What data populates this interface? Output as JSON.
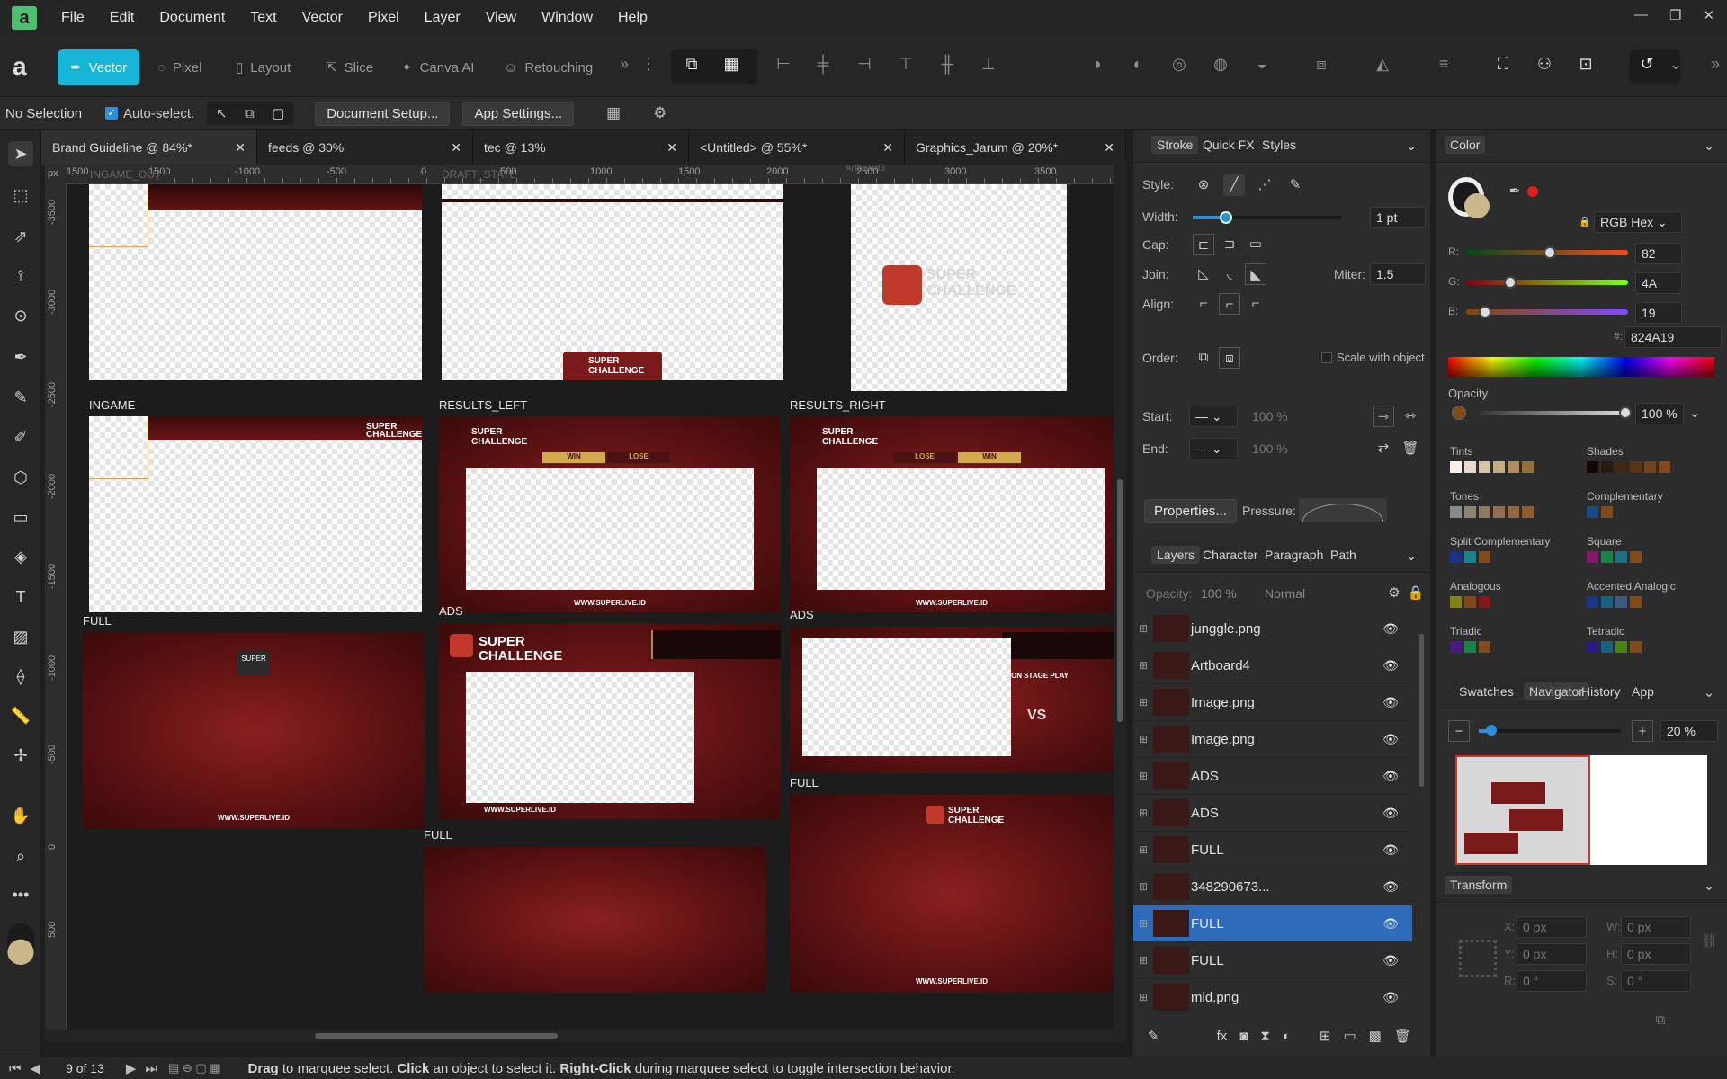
{
  "menu": [
    "File",
    "Edit",
    "Document",
    "Text",
    "Vector",
    "Pixel",
    "Layer",
    "View",
    "Window",
    "Help"
  ],
  "personas": [
    "Vector",
    "Pixel",
    "Layout",
    "Slice",
    "Canva AI",
    "Retouching"
  ],
  "context": {
    "selection": "No Selection",
    "autoselect": "Auto-select:",
    "doc_setup": "Document Setup...",
    "app_settings": "App Settings..."
  },
  "tabs": [
    "Brand Guideline @ 84%*",
    "feeds @ 30%",
    "tec @ 13%",
    "<Untitled> @ 55%*",
    "Graphics_Jarum @ 20%*"
  ],
  "ruler": {
    "unit": "px",
    "h": [
      "1500",
      "-1000",
      "-500",
      "0",
      "500",
      "1000",
      "1500",
      "2000",
      "2500",
      "3000",
      "3500"
    ],
    "v": [
      "-3500",
      "-3000",
      "-2500",
      "-2000",
      "-1500",
      "-1000",
      "-500",
      "0",
      "500"
    ],
    "ghost": [
      "INGAME_OUT",
      "DRAFT_STATE",
      "Artboard3"
    ]
  },
  "artboards": {
    "ingame": "INGAME",
    "results_left": "RESULTS_LEFT",
    "results_right": "RESULTS_RIGHT",
    "ads1": "ADS",
    "ads2": "ADS",
    "full1": "FULL",
    "full2": "FULL",
    "full3": "FULL",
    "brand": "SUPER CHALLENGE",
    "brand_line1": "SUPER",
    "brand_line2": "CHALLENGE",
    "www": "WWW.SUPERLIVE.ID",
    "win": "WIN",
    "lose": "LOSE",
    "onstage": "ON STAGE PLAY",
    "vs": "VS"
  },
  "stroke": {
    "tabs": [
      "Stroke",
      "Quick FX",
      "Styles"
    ],
    "style": "Style:",
    "width_label": "Width:",
    "width": "1 pt",
    "cap": "Cap:",
    "join": "Join:",
    "miter_label": "Miter:",
    "miter": "1.5",
    "align": "Align:",
    "order": "Order:",
    "scale": "Scale with object",
    "start": "Start:",
    "end": "End:",
    "start_pct": "100 %",
    "end_pct": "100 %",
    "properties": "Properties...",
    "pressure": "Pressure:"
  },
  "layers": {
    "tabs": [
      "Layers",
      "Character",
      "Paragraph",
      "Path"
    ],
    "opacity_label": "Opacity:",
    "opacity": "100 %",
    "blend": "Normal",
    "items": [
      "junggle.png",
      "Artboard4",
      "Image.png",
      "Image.png",
      "ADS",
      "ADS",
      "FULL",
      "348290673...",
      "FULL",
      "FULL",
      "mid.png"
    ],
    "selected": 8
  },
  "color": {
    "tab": "Color",
    "model": "RGB Hex",
    "r": "82",
    "g": "4A",
    "b": "19",
    "hex_label": "#:",
    "hex": "824A19",
    "opacity_label": "Opacity",
    "opacity": "100 %",
    "swatch_color": "#824A19",
    "groups": [
      "Tints",
      "Shades",
      "Tones",
      "Complementary",
      "Split Complementary",
      "Square",
      "Analogous",
      "Accented Analogic",
      "Triadic",
      "Tetradic"
    ]
  },
  "navigator": {
    "tabs": [
      "Swatches",
      "Navigator",
      "History",
      "App"
    ],
    "zoom": "20 %"
  },
  "transform": {
    "tab": "Transform",
    "x_label": "X:",
    "x": "0 px",
    "y_label": "Y:",
    "y": "0 px",
    "w_label": "W:",
    "w": "0 px",
    "h_label": "H:",
    "h": "0 px",
    "r_label": "R:",
    "r": "0 °",
    "s_label": "S:",
    "s": "0 °"
  },
  "status": {
    "page": "9 of 13",
    "hint_b1": "Drag",
    "hint_1": " to marquee select. ",
    "hint_b2": "Click",
    "hint_2": " an object to select it. ",
    "hint_b3": "Right-Click",
    "hint_3": " during marquee select to toggle intersection behavior."
  }
}
